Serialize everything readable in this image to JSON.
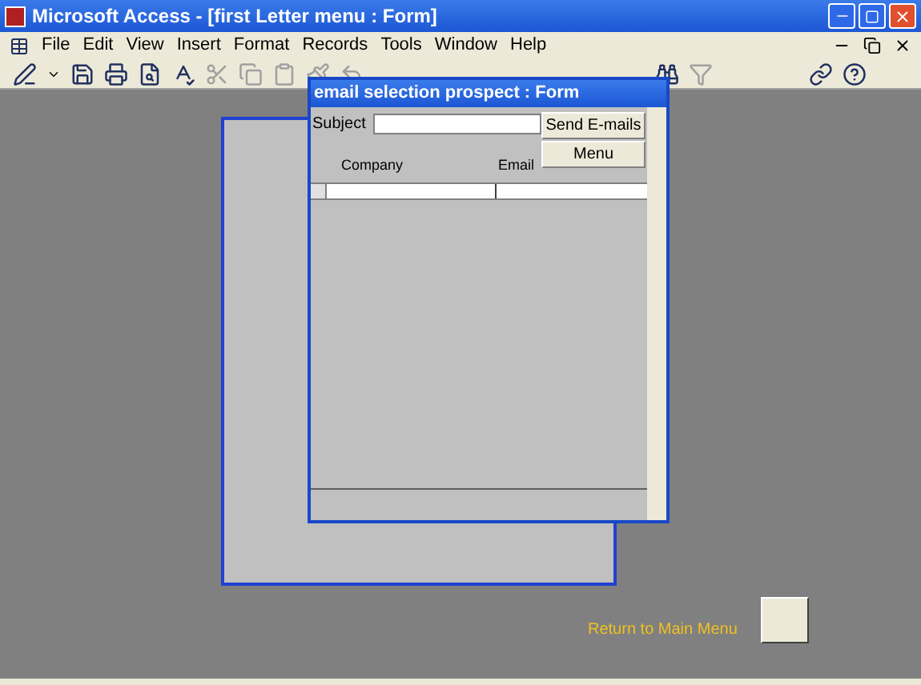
{
  "window": {
    "title": "Microsoft Access - [first Letter menu : Form]"
  },
  "menu": [
    "File",
    "Edit",
    "View",
    "Insert",
    "Format",
    "Records",
    "Tools",
    "Window",
    "Help"
  ],
  "popup_form": {
    "title": "email selection prospect : Form",
    "subject_label": "Subject",
    "buttons": [
      "Send E-mails",
      "Menu"
    ],
    "columns": [
      "Company",
      "Email"
    ]
  },
  "main_form": {
    "return_label": "Return to Main Menu"
  }
}
